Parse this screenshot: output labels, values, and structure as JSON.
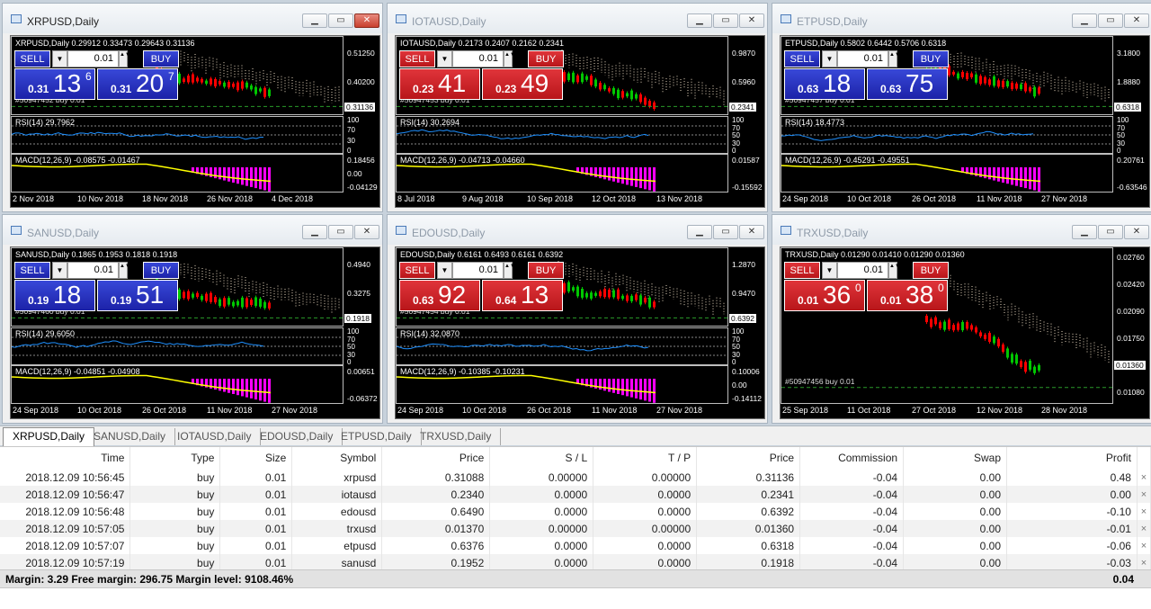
{
  "windows": [
    {
      "title": "XRPUSD,Daily",
      "active": true,
      "color": "blue",
      "symline": "XRPUSD,Daily  0.29912 0.33473 0.29643 0.31136",
      "volume": "0.01",
      "sell_label": "SELL",
      "buy_label": "BUY",
      "sell": {
        "small": "0.31",
        "big": "13",
        "sup": "6"
      },
      "buy": {
        "small": "0.31",
        "big": "20",
        "sup": "7"
      },
      "order": "#50947452 buy 0.01",
      "rsi": "RSI(14) 29.7962",
      "macd": "MACD(12,26,9) -0.08575 -0.01467",
      "price_axis": [
        "0.51250",
        "0.40200",
        "0.31136"
      ],
      "rsi_axis": [
        "100",
        "70",
        "30",
        "0"
      ],
      "macd_axis": [
        "0.18456",
        "0.00",
        "-0.04129"
      ],
      "dates": [
        "2 Nov 2018",
        "10 Nov 2018",
        "18 Nov 2018",
        "26 Nov 2018",
        "4 Dec 2018"
      ]
    },
    {
      "title": "IOTAUSD,Daily",
      "active": false,
      "color": "red",
      "symline": "IOTAUSD,Daily  0.2173 0.2407 0.2162 0.2341",
      "volume": "0.01",
      "sell_label": "SELL",
      "buy_label": "BUY",
      "sell": {
        "small": "0.23",
        "big": "41",
        "sup": ""
      },
      "buy": {
        "small": "0.23",
        "big": "49",
        "sup": ""
      },
      "order": "#50947453 buy 0.01",
      "rsi": "RSI(14) 30.2694",
      "macd": "MACD(12,26,9) -0.04713 -0.04660",
      "price_axis": [
        "0.9870",
        "0.5960",
        "0.2341"
      ],
      "rsi_axis": [
        "100",
        "70",
        "50",
        "30",
        "0"
      ],
      "macd_axis": [
        "0.01587",
        "-0.15592"
      ],
      "dates": [
        "8 Jul 2018",
        "9 Aug 2018",
        "10 Sep 2018",
        "12 Oct 2018",
        "13 Nov 2018"
      ]
    },
    {
      "title": "ETPUSD,Daily",
      "active": false,
      "color": "blue",
      "symline": "ETPUSD,Daily  0.5802 0.6442 0.5706 0.6318",
      "volume": "0.01",
      "sell_label": "SELL",
      "buy_label": "BUY",
      "sell": {
        "small": "0.63",
        "big": "18",
        "sup": ""
      },
      "buy": {
        "small": "0.63",
        "big": "75",
        "sup": ""
      },
      "order": "#50947457 buy 0.01",
      "rsi": "RSI(14) 18.4773",
      "macd": "MACD(12,26,9) -0.45291 -0.49551",
      "price_axis": [
        "3.1800",
        "1.8880",
        "0.6318"
      ],
      "rsi_axis": [
        "100",
        "70",
        "50",
        "30",
        "0"
      ],
      "macd_axis": [
        "0.20761",
        "-0.63546"
      ],
      "dates": [
        "24 Sep 2018",
        "10 Oct 2018",
        "26 Oct 2018",
        "11 Nov 2018",
        "27 Nov 2018"
      ]
    },
    {
      "title": "SANUSD,Daily",
      "active": false,
      "color": "blue",
      "symline": "SANUSD,Daily  0.1865 0.1953 0.1818 0.1918",
      "volume": "0.01",
      "sell_label": "SELL",
      "buy_label": "BUY",
      "sell": {
        "small": "0.19",
        "big": "18",
        "sup": ""
      },
      "buy": {
        "small": "0.19",
        "big": "51",
        "sup": ""
      },
      "order": "#50947460 buy 0.01",
      "rsi": "RSI(14) 29.6050",
      "macd": "MACD(12,26,9) -0.04851 -0.04908",
      "price_axis": [
        "0.4940",
        "0.3275",
        "0.1918"
      ],
      "rsi_axis": [
        "100",
        "70",
        "50",
        "30",
        "0"
      ],
      "macd_axis": [
        "0.00651",
        "-0.06372"
      ],
      "dates": [
        "24 Sep 2018",
        "10 Oct 2018",
        "26 Oct 2018",
        "11 Nov 2018",
        "27 Nov 2018"
      ]
    },
    {
      "title": "EDOUSD,Daily",
      "active": false,
      "color": "red",
      "symline": "EDOUSD,Daily  0.6161 0.6493 0.6161 0.6392",
      "volume": "0.01",
      "sell_label": "SELL",
      "buy_label": "BUY",
      "sell": {
        "small": "0.63",
        "big": "92",
        "sup": ""
      },
      "buy": {
        "small": "0.64",
        "big": "13",
        "sup": ""
      },
      "order": "#50947454 buy 0.01",
      "rsi": "RSI(14) 32.0870",
      "macd": "MACD(12,26,9) -0.10385 -0.10231",
      "price_axis": [
        "1.2870",
        "0.9470",
        "0.6392"
      ],
      "rsi_axis": [
        "100",
        "70",
        "50",
        "30",
        "0"
      ],
      "macd_axis": [
        "0.10006",
        "0.00",
        "-0.14112"
      ],
      "dates": [
        "24 Sep 2018",
        "10 Oct 2018",
        "26 Oct 2018",
        "11 Nov 2018",
        "27 Nov 2018"
      ]
    },
    {
      "title": "TRXUSD,Daily",
      "active": false,
      "color": "red",
      "symline": "TRXUSD,Daily  0.01290 0.01410 0.01290 0.01360",
      "volume": "0.01",
      "sell_label": "SELL",
      "buy_label": "BUY",
      "sell": {
        "small": "0.01",
        "big": "36",
        "sup": "0"
      },
      "buy": {
        "small": "0.01",
        "big": "38",
        "sup": "0"
      },
      "order": "#50947456 buy 0.01",
      "rsi": "",
      "macd": "",
      "price_axis": [
        "0.02760",
        "0.02420",
        "0.02090",
        "0.01750",
        "0.01360",
        "0.01080"
      ],
      "rsi_axis": [],
      "macd_axis": [],
      "dates": [
        "25 Sep 2018",
        "11 Oct 2018",
        "27 Oct 2018",
        "12 Nov 2018",
        "28 Nov 2018"
      ]
    }
  ],
  "tabs": [
    "XRPUSD,Daily",
    "SANUSD,Daily",
    "IOTAUSD,Daily",
    "EDOUSD,Daily",
    "ETPUSD,Daily",
    "TRXUSD,Daily"
  ],
  "table": {
    "headers": [
      "Time",
      "Type",
      "Size",
      "Symbol",
      "Price",
      "S / L",
      "T / P",
      "Price",
      "Commission",
      "Swap",
      "Profit"
    ],
    "rows": [
      [
        "2018.12.09 10:56:45",
        "buy",
        "0.01",
        "xrpusd",
        "0.31088",
        "0.00000",
        "0.00000",
        "0.31136",
        "-0.04",
        "0.00",
        "0.48"
      ],
      [
        "2018.12.09 10:56:47",
        "buy",
        "0.01",
        "iotausd",
        "0.2340",
        "0.0000",
        "0.0000",
        "0.2341",
        "-0.04",
        "0.00",
        "0.00"
      ],
      [
        "2018.12.09 10:56:48",
        "buy",
        "0.01",
        "edousd",
        "0.6490",
        "0.0000",
        "0.0000",
        "0.6392",
        "-0.04",
        "0.00",
        "-0.10"
      ],
      [
        "2018.12.09 10:57:05",
        "buy",
        "0.01",
        "trxusd",
        "0.01370",
        "0.00000",
        "0.00000",
        "0.01360",
        "-0.04",
        "0.00",
        "-0.01"
      ],
      [
        "2018.12.09 10:57:07",
        "buy",
        "0.01",
        "etpusd",
        "0.6376",
        "0.0000",
        "0.0000",
        "0.6318",
        "-0.04",
        "0.00",
        "-0.06"
      ],
      [
        "2018.12.09 10:57:19",
        "buy",
        "0.01",
        "sanusd",
        "0.1952",
        "0.0000",
        "0.0000",
        "0.1918",
        "-0.04",
        "0.00",
        "-0.03"
      ]
    ],
    "close_glyph": "×"
  },
  "summary": {
    "margin_text": "Margin: 3.29  Free margin: 296.75  Margin level: 9108.46%",
    "profit": "0.04"
  },
  "colors": {
    "chart_bg": "#000000",
    "bull": "#00c800",
    "bear": "#ff0000",
    "rsi_line": "#1e90ff",
    "macd_hist": "#ff00ff",
    "macd_signal": "#ffff00",
    "sell_blue": "#2430c0",
    "sell_red": "#d01c22"
  }
}
